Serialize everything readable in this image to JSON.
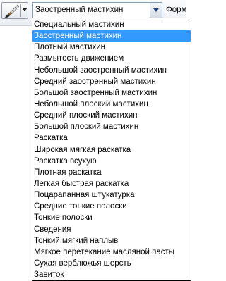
{
  "toolbar": {
    "tool_preset_icon": "brush-icon",
    "combo_value": "Заостренный мастихин",
    "form_label": "Форм"
  },
  "dropdown": {
    "selected_index": 1,
    "items": [
      {
        "label": "Специальный мастихин"
      },
      {
        "label": "Заостренный мастихин"
      },
      {
        "label": "Плотный мастихин"
      },
      {
        "label": "Размытость движением"
      },
      {
        "label": "Небольшой заостренный мастихин"
      },
      {
        "label": "Средний заостренный мастихин"
      },
      {
        "label": "Большой заостренный мастихин"
      },
      {
        "label": "Небольшой плоский мастихин"
      },
      {
        "label": "Средний плоский мастихин"
      },
      {
        "label": "Большой плоский мастихин"
      },
      {
        "label": "Раскатка"
      },
      {
        "label": "Широкая мягкая раскатка"
      },
      {
        "label": "Раскатка всухую"
      },
      {
        "label": "Плотная раскатка"
      },
      {
        "label": "Легкая быстрая раскатка"
      },
      {
        "label": "Поцарапанная штукатурка"
      },
      {
        "label": "Средние тонкие полоски"
      },
      {
        "label": "Тонкие полоски"
      },
      {
        "label": "Сведения"
      },
      {
        "label": "Тонкий мягкий наплыв"
      },
      {
        "label": "Мягкое перетекание масляной пасты"
      },
      {
        "label": "Сухая верблюжья шерсть"
      },
      {
        "label": "Завиток"
      }
    ]
  },
  "colors": {
    "selection": "#3399ff",
    "combo_border": "#7f9db9"
  }
}
